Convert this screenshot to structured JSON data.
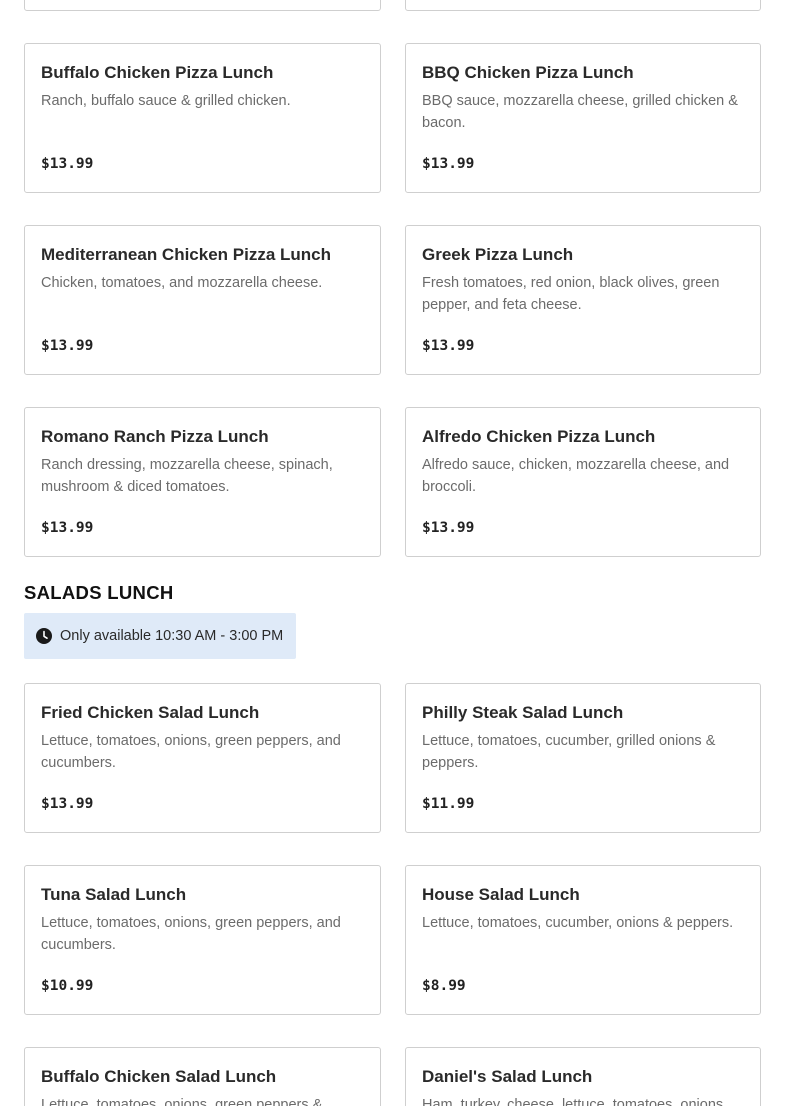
{
  "top_cards": [
    {
      "name": "",
      "description": "",
      "price": ""
    },
    {
      "name": "",
      "description": "",
      "price": ""
    }
  ],
  "pizza_items": [
    {
      "name": "Buffalo Chicken Pizza Lunch",
      "description": "Ranch, buffalo sauce & grilled chicken.",
      "price": "$13.99"
    },
    {
      "name": "BBQ Chicken Pizza Lunch",
      "description": "BBQ sauce, mozzarella cheese, grilled chicken & bacon.",
      "price": "$13.99"
    },
    {
      "name": "Mediterranean Chicken Pizza Lunch",
      "description": "Chicken, tomatoes, and mozzarella cheese.",
      "price": "$13.99"
    },
    {
      "name": "Greek Pizza Lunch",
      "description": "Fresh tomatoes, red onion, black olives, green pepper, and feta cheese.",
      "price": "$13.99"
    },
    {
      "name": "Romano Ranch Pizza Lunch",
      "description": "Ranch dressing, mozzarella cheese, spinach, mushroom & diced tomatoes.",
      "price": "$13.99"
    },
    {
      "name": "Alfredo Chicken Pizza Lunch",
      "description": "Alfredo sauce, chicken, mozzarella cheese, and broccoli.",
      "price": "$13.99"
    }
  ],
  "salads_section": {
    "title": "SALADS LUNCH",
    "availability_icon": "clock-icon",
    "availability_text": "Only available 10:30 AM - 3:00 PM",
    "availability_bg": "#dfeaf8"
  },
  "salad_items": [
    {
      "name": "Fried Chicken Salad Lunch",
      "description": "Lettuce, tomatoes, onions, green peppers, and cucumbers.",
      "price": "$13.99"
    },
    {
      "name": "Philly Steak Salad Lunch",
      "description": "Lettuce, tomatoes, cucumber, grilled onions & peppers.",
      "price": "$11.99"
    },
    {
      "name": "Tuna Salad Lunch",
      "description": "Lettuce, tomatoes, onions, green peppers, and cucumbers.",
      "price": "$10.99"
    },
    {
      "name": "House Salad Lunch",
      "description": "Lettuce, tomatoes, cucumber, onions & peppers.",
      "price": "$8.99"
    },
    {
      "name": "Buffalo Chicken Salad Lunch",
      "description": "Lettuce, tomatoes, onions, green peppers &",
      "price": ""
    },
    {
      "name": "Daniel's Salad Lunch",
      "description": "Ham, turkey, cheese, lettuce, tomatoes, onions",
      "price": ""
    }
  ]
}
